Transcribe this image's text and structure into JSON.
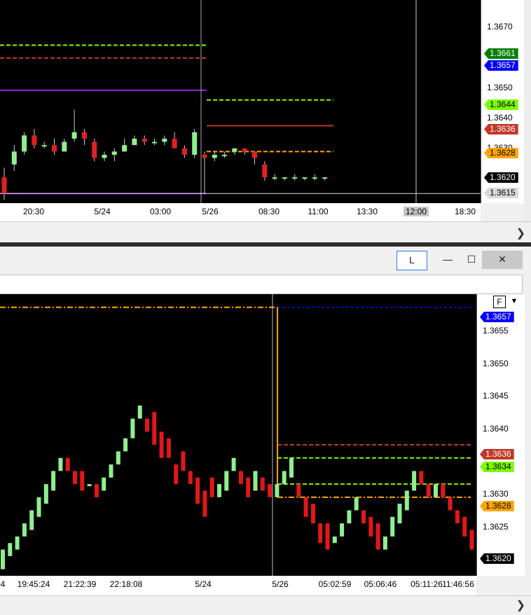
{
  "top_chart": {
    "y_ticks": [
      "1.3670",
      "1.3650",
      "1.3640",
      "1.3630"
    ],
    "price_tags": [
      {
        "label": "1.3661",
        "color": "#008000"
      },
      {
        "label": "1.3657",
        "color": "#0000ff"
      },
      {
        "label": "1.3644",
        "color": "#7cfc00"
      },
      {
        "label": "1.3636",
        "color": "#c0392b"
      },
      {
        "label": "1.3628",
        "color": "#ffa500"
      },
      {
        "label": "1.3620",
        "color": "#000000"
      },
      {
        "label": "1.3615",
        "color": "#d8d8d8"
      }
    ],
    "time_labels": [
      "20:30",
      "5/24",
      "03:00",
      "5/26",
      "08:30",
      "11:00",
      "13:30",
      "12:00",
      "18:30"
    ]
  },
  "bottom_chart": {
    "y_ticks": [
      "1.3655",
      "1.3650",
      "1.3645",
      "1.3640",
      "1.3630",
      "1.3625"
    ],
    "price_tags": [
      {
        "label": "1.3657",
        "color": "#0000ff"
      },
      {
        "label": "1.3636",
        "color": "#c0392b"
      },
      {
        "label": "1.3634",
        "color": "#7cfc00"
      },
      {
        "label": "1.3628",
        "color": "#ffa500"
      },
      {
        "label": "1.3620",
        "color": "#000000"
      }
    ],
    "time_labels": [
      "4",
      "19:45:24",
      "21:22:39",
      "22:18:08",
      "5/24",
      "5/26",
      "05:02:59",
      "05:06:46",
      "05:11:26",
      "11:46:56"
    ]
  },
  "window": {
    "link_button": "L",
    "minimize_icon": "minimize-icon",
    "maximize_icon": "maximize-icon",
    "close_icon": "close-icon",
    "f_label": "F",
    "dropdown_icon": "triangle-down-icon",
    "scroll_icon": "chevron-right-icon"
  },
  "chart_data": [
    {
      "type": "candlestick",
      "description_label": "",
      "ylim": [
        1.3612,
        1.3675
      ],
      "reference_lines": [
        {
          "value": 1.3661,
          "color": "#7cfc00",
          "style": "dashed"
        },
        {
          "value": 1.3657,
          "color": "#c0392b",
          "style": "dashed"
        },
        {
          "value": 1.3647,
          "color": "#8a2be2",
          "style": "solid"
        },
        {
          "value": 1.3644,
          "color": "#7cfc00",
          "style": "dashed"
        },
        {
          "value": 1.3636,
          "color": "#c0392b",
          "style": "solid"
        },
        {
          "value": 1.3628,
          "color": "#ffa500",
          "style": "dashed"
        },
        {
          "value": 1.3615,
          "color": "#8a2be2",
          "style": "solid"
        }
      ],
      "candles": [
        {
          "o": 1.362,
          "c": 1.3615,
          "h": 1.3623,
          "l": 1.3613
        },
        {
          "o": 1.3624,
          "c": 1.3628,
          "h": 1.363,
          "l": 1.3622
        },
        {
          "o": 1.3628,
          "c": 1.3633,
          "h": 1.3634,
          "l": 1.3627
        },
        {
          "o": 1.3633,
          "c": 1.363,
          "h": 1.3635,
          "l": 1.3629
        },
        {
          "o": 1.363,
          "c": 1.363,
          "h": 1.3631,
          "l": 1.3629
        },
        {
          "o": 1.363,
          "c": 1.3628,
          "h": 1.3632,
          "l": 1.3627
        },
        {
          "o": 1.3628,
          "c": 1.3631,
          "h": 1.3632,
          "l": 1.3628
        },
        {
          "o": 1.3632,
          "c": 1.3634,
          "h": 1.3641,
          "l": 1.3631
        },
        {
          "o": 1.3634,
          "c": 1.3632,
          "h": 1.3635,
          "l": 1.363
        },
        {
          "o": 1.3631,
          "c": 1.3626,
          "h": 1.3632,
          "l": 1.3625
        },
        {
          "o": 1.3626,
          "c": 1.3627,
          "h": 1.3628,
          "l": 1.3625
        },
        {
          "o": 1.3627,
          "c": 1.3628,
          "h": 1.3629,
          "l": 1.3625
        },
        {
          "o": 1.3628,
          "c": 1.363,
          "h": 1.3632,
          "l": 1.3628
        },
        {
          "o": 1.363,
          "c": 1.3632,
          "h": 1.3633,
          "l": 1.363
        },
        {
          "o": 1.3632,
          "c": 1.3631,
          "h": 1.3633,
          "l": 1.363
        },
        {
          "o": 1.3631,
          "c": 1.3631,
          "h": 1.3632,
          "l": 1.363
        },
        {
          "o": 1.3631,
          "c": 1.3632,
          "h": 1.3633,
          "l": 1.363
        },
        {
          "o": 1.3632,
          "c": 1.3629,
          "h": 1.3634,
          "l": 1.3629
        },
        {
          "o": 1.3629,
          "c": 1.3627,
          "h": 1.363,
          "l": 1.3626
        },
        {
          "o": 1.3627,
          "c": 1.3634,
          "h": 1.3635,
          "l": 1.3626
        },
        {
          "o": 1.3627,
          "c": 1.3626,
          "h": 1.3628,
          "l": 1.3615
        },
        {
          "o": 1.3626,
          "c": 1.3627,
          "h": 1.3628,
          "l": 1.3625
        },
        {
          "o": 1.3627,
          "c": 1.3627,
          "h": 1.3628,
          "l": 1.3626
        },
        {
          "o": 1.3628,
          "c": 1.3629,
          "h": 1.3629,
          "l": 1.3627
        },
        {
          "o": 1.3629,
          "c": 1.3628,
          "h": 1.3629,
          "l": 1.3627
        },
        {
          "o": 1.3628,
          "c": 1.3626,
          "h": 1.3628,
          "l": 1.3624
        },
        {
          "o": 1.3624,
          "c": 1.362,
          "h": 1.3625,
          "l": 1.3619
        },
        {
          "o": 1.362,
          "c": 1.362,
          "h": 1.3621,
          "l": 1.3619
        },
        {
          "o": 1.362,
          "c": 1.362,
          "h": 1.362,
          "l": 1.3619
        },
        {
          "o": 1.362,
          "c": 1.362,
          "h": 1.3621,
          "l": 1.3619
        },
        {
          "o": 1.362,
          "c": 1.362,
          "h": 1.362,
          "l": 1.3619
        },
        {
          "o": 1.362,
          "c": 1.362,
          "h": 1.3621,
          "l": 1.3619
        },
        {
          "o": 1.362,
          "c": 1.362,
          "h": 1.362,
          "l": 1.3619
        }
      ]
    },
    {
      "type": "bar",
      "description_label": "",
      "ylim": [
        1.3616,
        1.3659
      ],
      "reference_lines": [
        {
          "value": 1.3657,
          "color": "#ffa500",
          "style": "dashdot"
        },
        {
          "value": 1.3636,
          "color": "#c0392b",
          "style": "dashed"
        },
        {
          "value": 1.3634,
          "color": "#7cfc00",
          "style": "dashed"
        },
        {
          "value": 1.363,
          "color": "#7cfc00",
          "style": "dashed"
        },
        {
          "value": 1.3628,
          "color": "#ffa500",
          "style": "dashdot"
        }
      ],
      "bars": [
        {
          "o": 1.3617,
          "c": 1.362
        },
        {
          "o": 1.3619,
          "c": 1.3621
        },
        {
          "o": 1.362,
          "c": 1.3622
        },
        {
          "o": 1.3622,
          "c": 1.3624
        },
        {
          "o": 1.3623,
          "c": 1.3626
        },
        {
          "o": 1.3625,
          "c": 1.3628
        },
        {
          "o": 1.3627,
          "c": 1.363
        },
        {
          "o": 1.3629,
          "c": 1.3632
        },
        {
          "o": 1.3632,
          "c": 1.3634
        },
        {
          "o": 1.3634,
          "c": 1.3632
        },
        {
          "o": 1.3632,
          "c": 1.363
        },
        {
          "o": 1.3632,
          "c": 1.3629
        },
        {
          "o": 1.363,
          "c": 1.363
        },
        {
          "o": 1.363,
          "c": 1.3628
        },
        {
          "o": 1.3629,
          "c": 1.3631
        },
        {
          "o": 1.3631,
          "c": 1.3633
        },
        {
          "o": 1.3633,
          "c": 1.3635
        },
        {
          "o": 1.3635,
          "c": 1.3637
        },
        {
          "o": 1.3637,
          "c": 1.364
        },
        {
          "o": 1.364,
          "c": 1.3642
        },
        {
          "o": 1.364,
          "c": 1.3638
        },
        {
          "o": 1.3641,
          "c": 1.3636
        },
        {
          "o": 1.3638,
          "c": 1.3634
        },
        {
          "o": 1.3637,
          "c": 1.3634
        },
        {
          "o": 1.3633,
          "c": 1.363
        },
        {
          "o": 1.3635,
          "c": 1.3632
        },
        {
          "o": 1.3632,
          "c": 1.363
        },
        {
          "o": 1.3631,
          "c": 1.3627
        },
        {
          "o": 1.3629,
          "c": 1.3625
        },
        {
          "o": 1.3631,
          "c": 1.3628
        },
        {
          "o": 1.3628,
          "c": 1.363
        },
        {
          "o": 1.3629,
          "c": 1.3632
        },
        {
          "o": 1.3632,
          "c": 1.3634
        },
        {
          "o": 1.3632,
          "c": 1.363
        },
        {
          "o": 1.3631,
          "c": 1.3628
        },
        {
          "o": 1.3629,
          "c": 1.3632
        },
        {
          "o": 1.3631,
          "c": 1.3629
        },
        {
          "o": 1.363,
          "c": 1.3628
        },
        {
          "o": 1.3628,
          "c": 1.363
        },
        {
          "o": 1.363,
          "c": 1.3632
        },
        {
          "o": 1.3631,
          "c": 1.3634
        },
        {
          "o": 1.363,
          "c": 1.3628
        },
        {
          "o": 1.3628,
          "c": 1.3625
        },
        {
          "o": 1.3627,
          "c": 1.3624
        },
        {
          "o": 1.3624,
          "c": 1.3621
        },
        {
          "o": 1.3624,
          "c": 1.362
        },
        {
          "o": 1.3621,
          "c": 1.3622
        },
        {
          "o": 1.3622,
          "c": 1.3624
        },
        {
          "o": 1.3624,
          "c": 1.3626
        },
        {
          "o": 1.3626,
          "c": 1.3628
        },
        {
          "o": 1.3626,
          "c": 1.3624
        },
        {
          "o": 1.3625,
          "c": 1.3622
        },
        {
          "o": 1.3624,
          "c": 1.362
        },
        {
          "o": 1.362,
          "c": 1.3622
        },
        {
          "o": 1.3622,
          "c": 1.3625
        },
        {
          "o": 1.3624,
          "c": 1.3627
        },
        {
          "o": 1.3626,
          "c": 1.3629
        },
        {
          "o": 1.3629,
          "c": 1.3632
        },
        {
          "o": 1.3632,
          "c": 1.363
        },
        {
          "o": 1.363,
          "c": 1.3628
        },
        {
          "o": 1.3628,
          "c": 1.363
        },
        {
          "o": 1.363,
          "c": 1.3628
        },
        {
          "o": 1.3628,
          "c": 1.3626
        },
        {
          "o": 1.3626,
          "c": 1.3624
        },
        {
          "o": 1.3625,
          "c": 1.3622
        },
        {
          "o": 1.3623,
          "c": 1.362
        },
        {
          "o": 1.3622,
          "c": 1.362
        }
      ]
    }
  ]
}
